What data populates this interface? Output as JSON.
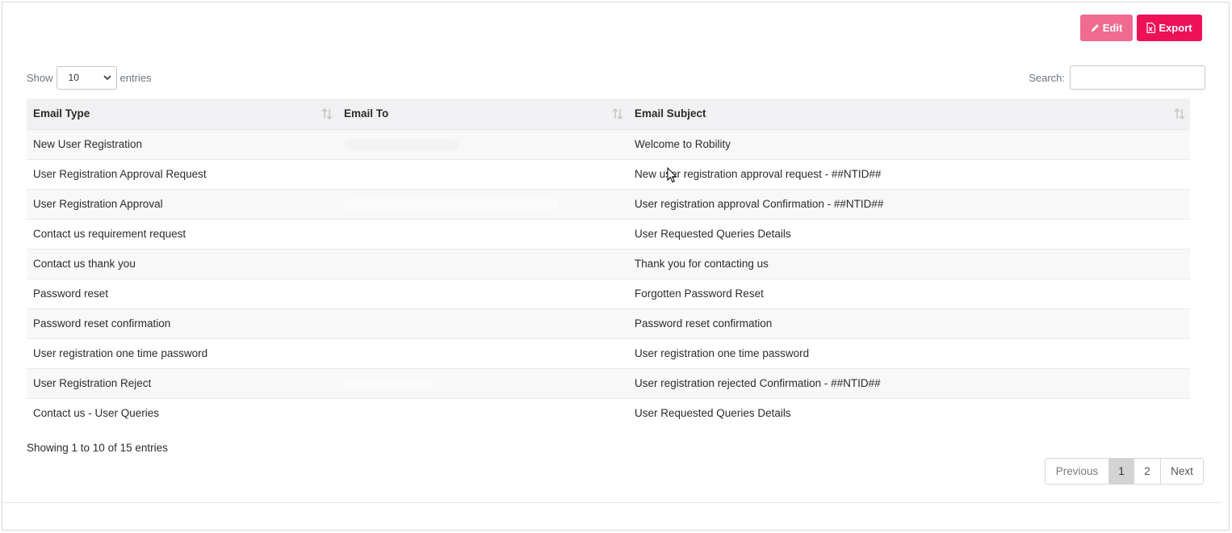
{
  "toolbar": {
    "edit_label": "Edit",
    "export_label": "Export"
  },
  "length_control": {
    "prefix": "Show",
    "value": "10",
    "suffix": "entries"
  },
  "search": {
    "label": "Search:",
    "value": ""
  },
  "table": {
    "headers": [
      "Email Type",
      "Email To",
      "Email Subject"
    ],
    "rows": [
      {
        "type": "New User Registration",
        "subject": "Welcome to Robility"
      },
      {
        "type": "User Registration Approval Request",
        "subject": "New user registration approval request - ##NTID##"
      },
      {
        "type": "User Registration Approval",
        "subject": "User registration approval Confirmation - ##NTID##"
      },
      {
        "type": "Contact us requirement request",
        "subject": "User Requested Queries Details"
      },
      {
        "type": "Contact us thank you",
        "subject": "Thank you for contacting us"
      },
      {
        "type": "Password reset",
        "subject": "Forgotten Password Reset"
      },
      {
        "type": "Password reset confirmation",
        "subject": "Password reset confirmation"
      },
      {
        "type": "User registration one time password",
        "subject": "User registration one time password"
      },
      {
        "type": "User Registration Reject",
        "subject": "User registration rejected Confirmation - ##NTID##"
      },
      {
        "type": "Contact us - User Queries",
        "subject": "User Requested Queries Details"
      }
    ]
  },
  "info": "Showing 1 to 10 of 15 entries",
  "pagination": {
    "previous": "Previous",
    "pages": [
      "1",
      "2"
    ],
    "next": "Next",
    "active": "1"
  },
  "colors": {
    "edit": "#f06b8f",
    "export": "#ee1058",
    "active_page": "#d3d3d3"
  }
}
